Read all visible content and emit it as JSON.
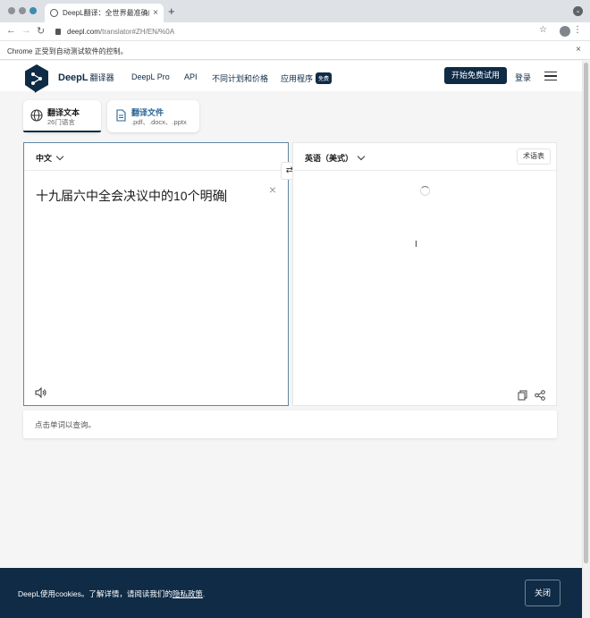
{
  "browser": {
    "tab_title": "DeepL翻译：全世界最准确的翻译",
    "tab_close": "×",
    "new_tab": "+",
    "url_host": "deepl.com",
    "url_path": "/translator#ZH/EN/%0A",
    "automation_notice": "Chrome 正受到自动测试软件的控制。",
    "notice_close": "×"
  },
  "header": {
    "brand": "DeepL",
    "brand_sub": "翻译器",
    "nav": {
      "pro": "DeepL Pro",
      "api": "API",
      "plans": "不同计划和价格",
      "apps": "应用程序",
      "apps_badge": "免费"
    },
    "trial": "开始免费试用",
    "login": "登录"
  },
  "modes": {
    "text": {
      "title": "翻译文本",
      "sub": "26门语言"
    },
    "file": {
      "title": "翻译文件",
      "sub": ".pdf、.docx、.pptx"
    }
  },
  "source": {
    "lang": "中文",
    "text": "十九届六中全会决议中的10个明确",
    "clear": "×"
  },
  "swap": "⇄",
  "target": {
    "lang": "英语（美式）",
    "glossary": "术语表"
  },
  "hint": "点击单词以查询。",
  "cookie": {
    "msg_before": "DeepL使用cookies。了解详情，请阅读我们的",
    "link": "隐私政策",
    "msg_after": ".",
    "close": "关闭"
  },
  "colors": {
    "brand_navy": "#0f2b46",
    "active_border": "#5e86a3",
    "page_bg": "#f5f5f5"
  }
}
